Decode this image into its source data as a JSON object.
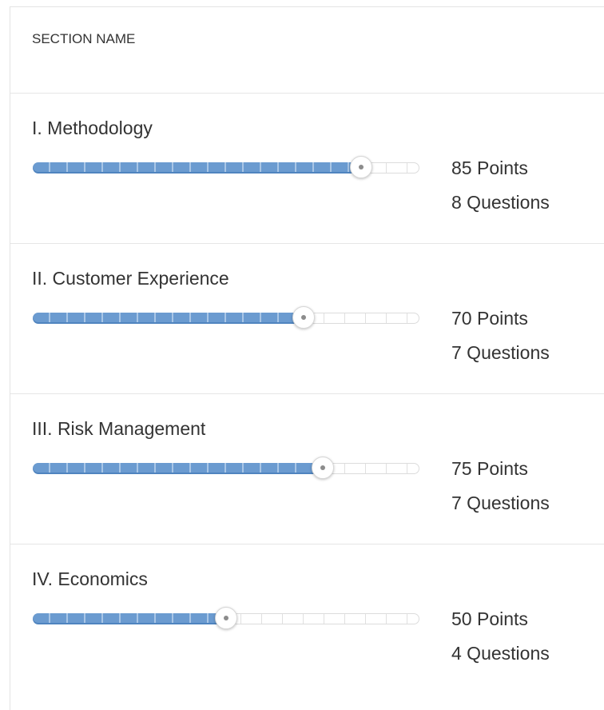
{
  "header": {
    "section_name_label": "SECTION NAME"
  },
  "sections": [
    {
      "title": "I. Methodology",
      "score_fraction": 0.85,
      "points_label": "85 Points",
      "questions_label": "8 Questions"
    },
    {
      "title": "II. Customer Experience",
      "score_fraction": 0.7,
      "points_label": "70 Points",
      "questions_label": "7 Questions"
    },
    {
      "title": "III. Risk Management",
      "score_fraction": 0.75,
      "points_label": "75 Points",
      "questions_label": "7 Questions"
    },
    {
      "title": "IV. Economics",
      "score_fraction": 0.5,
      "points_label": "50 Points",
      "questions_label": "4 Questions"
    }
  ],
  "colors": {
    "slider_fill": "#6b9bd0",
    "slider_track": "#ffffff",
    "divider": "#e6e6e6"
  }
}
